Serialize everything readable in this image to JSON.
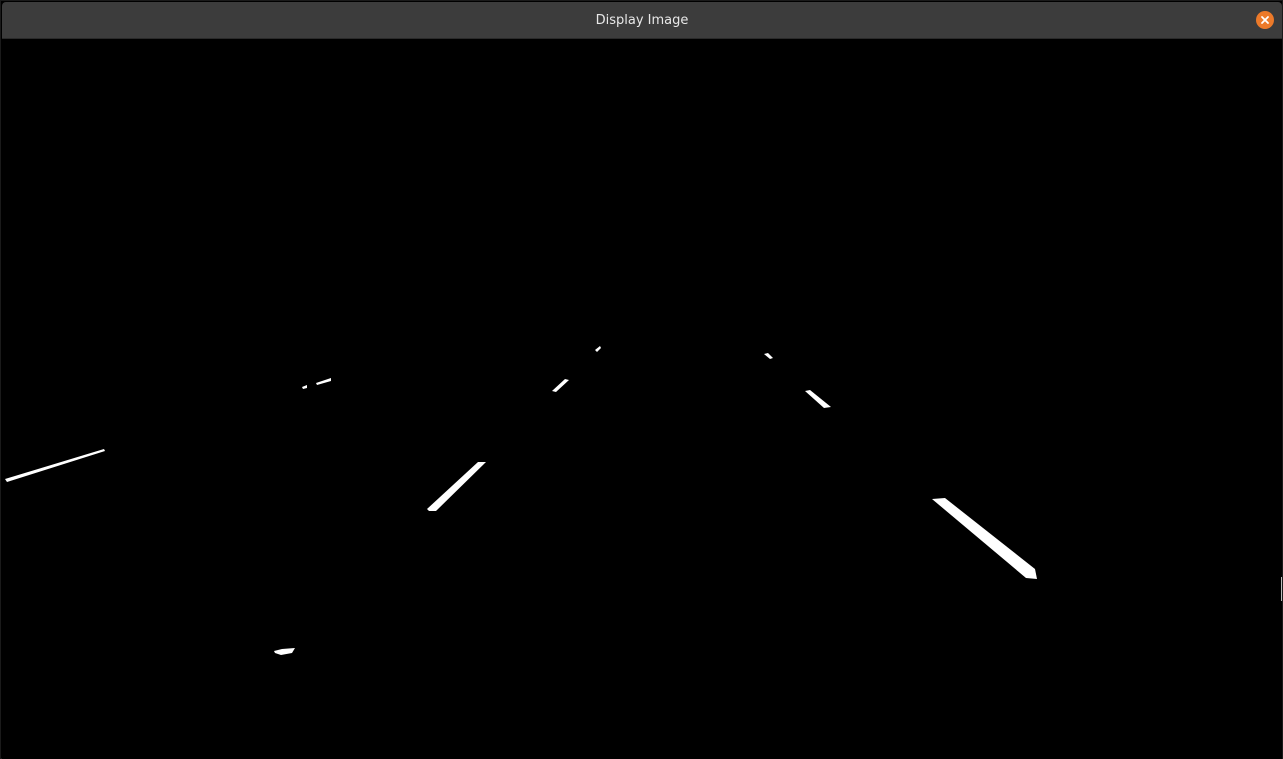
{
  "window": {
    "title": "Display Image"
  },
  "titlebar": {
    "close_icon": "close-icon",
    "close_color": "#ec7a2a"
  },
  "image": {
    "description_kind": "binary lane-line mask",
    "background_color": "#000000",
    "foreground_color": "#ffffff"
  }
}
